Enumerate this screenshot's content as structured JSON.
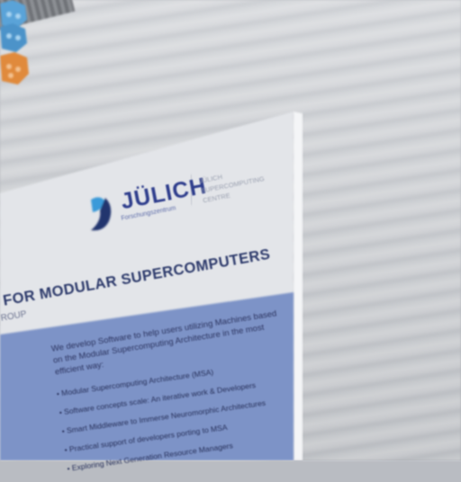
{
  "logo": {
    "wordmark": "JÜLICH",
    "subline": "Forschungszentrum",
    "center_name": "JÜLICH SUPERCOMPUTING CENTRE"
  },
  "poster": {
    "headline": "FOR MODULAR SUPERCOMPUTERS",
    "group_fragment": "ROUP",
    "intro": "We develop Software to help users utilizing Machines based on the Modular Supercomputing Architecture in the most efficient way:",
    "bullets": [
      "Modular Supercomputing Architecture (MSA)",
      "Software concepts scale: An iterative work & Developers",
      "Smart Middleware to Immerse Neuromorphic Architectures",
      "Practical support of developers porting to MSA",
      "Exploring Next Generation Resource Managers"
    ]
  },
  "colors": {
    "board": "#e4e6ea",
    "panel_blue": "#7f95c9",
    "brand_blue": "#2e3d8c",
    "hex_blue": "#5aa3d8",
    "hex_orange": "#e08a3c"
  }
}
